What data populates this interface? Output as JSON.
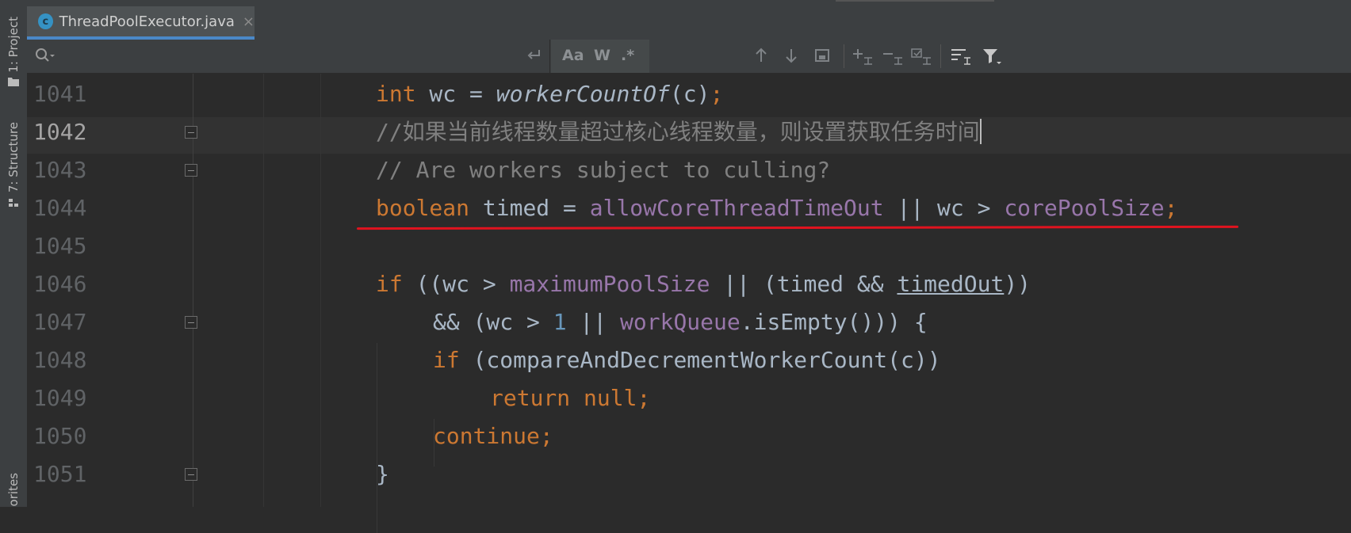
{
  "sidebar": {
    "project_label": "1: Project",
    "structure_label": "7: Structure",
    "favorites_label": "orites"
  },
  "tab": {
    "icon_letter": "c",
    "label": "ThreadPoolExecutor.java",
    "close": "×"
  },
  "find_bar": {
    "search_icon": "search-icon",
    "options": [
      "Aa",
      "W",
      ".*"
    ],
    "toolbar_icons": [
      "arrow-up-icon",
      "arrow-down-icon",
      "select-all-icon",
      "add-selection-icon",
      "remove-selection-icon",
      "select-all-occurrences-icon",
      "multiline-icon",
      "filter-icon"
    ]
  },
  "editor": {
    "lines": [
      {
        "no": "1041"
      },
      {
        "no": "1042"
      },
      {
        "no": "1043"
      },
      {
        "no": "1044"
      },
      {
        "no": "1045"
      },
      {
        "no": "1046"
      },
      {
        "no": "1047"
      },
      {
        "no": "1048"
      },
      {
        "no": "1049"
      },
      {
        "no": "1050"
      },
      {
        "no": "1051"
      }
    ],
    "code": {
      "l1041": {
        "kw": "int",
        "a": " wc = ",
        "method": "workerCountOf",
        "b": "(c)",
        "semi": ";"
      },
      "l1042": {
        "comment": "//如果当前线程数量超过核心线程数量，则设置获取任务时间"
      },
      "l1043": {
        "comment": "// Are workers subject to culling?"
      },
      "l1044": {
        "kw": "boolean",
        "a": " timed = ",
        "f1": "allowCoreThreadTimeOut",
        "b": " || wc > ",
        "f2": "corePoolSize",
        "semi": ";"
      },
      "l1046": {
        "kw": "if",
        "a": " ((wc > ",
        "f1": "maximumPoolSize",
        "b": " || (timed && ",
        "ul": "timedOut",
        "c": "))"
      },
      "l1047": {
        "a": "&& (wc > ",
        "num": "1",
        "b": " || ",
        "f1": "workQueue",
        "c": ".isEmpty())) {"
      },
      "l1048": {
        "kw": "if",
        "a": " (compareAndDecrementWorkerCount(c))"
      },
      "l1049": {
        "kw1": "return",
        "sp": " ",
        "kw2": "null",
        "semi": ";"
      },
      "l1050": {
        "kw": "continue",
        "semi": ";"
      },
      "l1051": {
        "a": "}"
      }
    }
  },
  "colors": {
    "keyword": "#cc7832",
    "field": "#9876aa",
    "comment": "#808080",
    "number": "#6897bb",
    "annotation_underline": "#e0131f"
  }
}
